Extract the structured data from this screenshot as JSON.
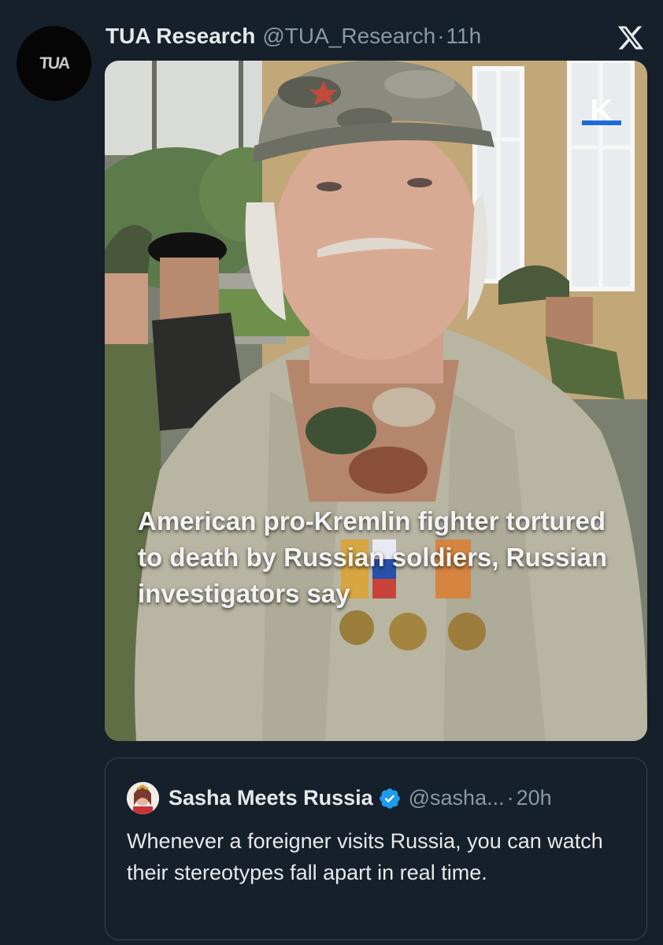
{
  "author": {
    "avatar_text": "TUA",
    "display_name": "TUA Research",
    "handle": "@TUA_Research",
    "separator": "·",
    "time": "11h"
  },
  "platform_icon": "x-logo-icon",
  "media": {
    "badge_letter": "K",
    "caption": "American pro-Kremlin fighter tortured to death by Russian soldiers, Russian investigators say"
  },
  "quoted_post": {
    "display_name": "Sasha Meets Russia",
    "verified_icon": "verified-badge-icon",
    "handle": "@sasha...",
    "separator": "·",
    "time": "20h",
    "text": "Whenever a foreigner visits Russia, you can watch their stereotypes fall apart in real time."
  },
  "colors": {
    "background": "#15202b",
    "primary_text": "#e7e9ea",
    "secondary_text": "#8b98a5",
    "border": "#38444d",
    "verified_blue": "#1d9bf0",
    "badge_underline": "#1d6bd8"
  }
}
